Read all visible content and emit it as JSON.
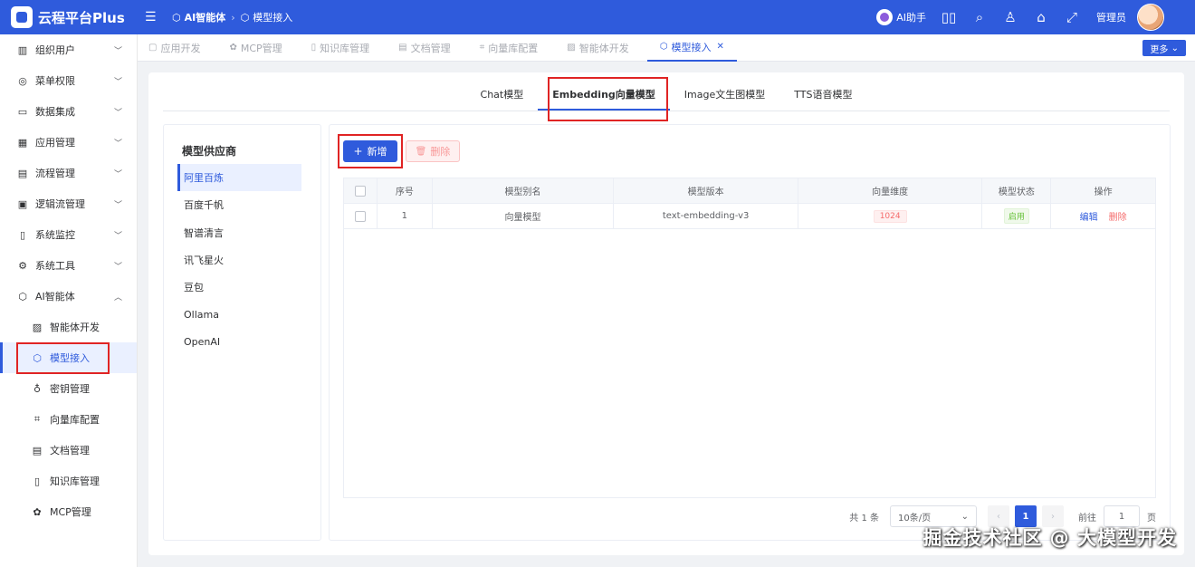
{
  "header": {
    "app_title": "云程平台Plus",
    "breadcrumbs": [
      "AI智能体",
      "模型接入"
    ],
    "ai_assistant": "AI助手",
    "user": "管理员"
  },
  "sidebar": {
    "items": [
      {
        "label": "组织用户",
        "icon": "building-icon",
        "glyph": "▥",
        "expanded": false
      },
      {
        "label": "菜单权限",
        "icon": "menu-circle-icon",
        "glyph": "◎",
        "expanded": false
      },
      {
        "label": "数据集成",
        "icon": "briefcase-icon",
        "glyph": "▭",
        "expanded": false
      },
      {
        "label": "应用管理",
        "icon": "grid-icon",
        "glyph": "▦",
        "expanded": false
      },
      {
        "label": "流程管理",
        "icon": "flow-icon",
        "glyph": "▤",
        "expanded": false
      },
      {
        "label": "逻辑流管理",
        "icon": "logic-icon",
        "glyph": "▣",
        "expanded": false
      },
      {
        "label": "系统监控",
        "icon": "monitor-icon",
        "glyph": "▯",
        "expanded": false
      },
      {
        "label": "系统工具",
        "icon": "gear-icon",
        "glyph": "⚙",
        "expanded": false
      },
      {
        "label": "AI智能体",
        "icon": "ai-icon",
        "glyph": "⬡",
        "expanded": true
      }
    ],
    "sub_items": [
      {
        "label": "智能体开发",
        "icon": "image-icon",
        "glyph": "▨"
      },
      {
        "label": "模型接入",
        "icon": "model-icon",
        "glyph": "⬡",
        "active": true
      },
      {
        "label": "密钥管理",
        "icon": "key-icon",
        "glyph": "♁"
      },
      {
        "label": "向量库配置",
        "icon": "crop-icon",
        "glyph": "⌗"
      },
      {
        "label": "文档管理",
        "icon": "document-icon",
        "glyph": "▤"
      },
      {
        "label": "知识库管理",
        "icon": "book-icon",
        "glyph": "▯"
      },
      {
        "label": "MCP管理",
        "icon": "gear-icon",
        "glyph": "✿"
      }
    ]
  },
  "page_tabs": [
    {
      "label": "应用开发",
      "glyph": "▢"
    },
    {
      "label": "MCP管理",
      "glyph": "✿"
    },
    {
      "label": "知识库管理",
      "glyph": "▯"
    },
    {
      "label": "文档管理",
      "glyph": "▤"
    },
    {
      "label": "向量库配置",
      "glyph": "⌗"
    },
    {
      "label": "智能体开发",
      "glyph": "▨"
    },
    {
      "label": "模型接入",
      "glyph": "⬡",
      "active": true,
      "close": "✕"
    }
  ],
  "more_button": "更多",
  "model_tabs": [
    {
      "label": "Chat模型",
      "active": false
    },
    {
      "label": "Embedding向量模型",
      "active": true
    },
    {
      "label": "Image文生图模型",
      "active": false
    },
    {
      "label": "TTS语音模型",
      "active": false
    }
  ],
  "providers": {
    "title": "模型供应商",
    "items": [
      {
        "label": "阿里百炼",
        "active": true
      },
      {
        "label": "百度千帆",
        "active": false
      },
      {
        "label": "智谱清言",
        "active": false
      },
      {
        "label": "讯飞星火",
        "active": false
      },
      {
        "label": "豆包",
        "active": false
      },
      {
        "label": "Ollama",
        "active": false
      },
      {
        "label": "OpenAI",
        "active": false
      }
    ]
  },
  "toolbar": {
    "add_label": "新增",
    "delete_label": "删除"
  },
  "table": {
    "columns": [
      "序号",
      "模型别名",
      "模型版本",
      "向量维度",
      "模型状态",
      "操作"
    ],
    "rows": [
      {
        "index": "1",
        "alias": "向量模型",
        "version": "text-embedding-v3",
        "dimension": "1024",
        "status": "启用",
        "edit": "编辑",
        "delete": "删除"
      }
    ]
  },
  "pagination": {
    "total_text": "共 1 条",
    "page_size": "10条/页",
    "current_page": "1",
    "goto_label": "前往",
    "goto_value": "1",
    "page_suffix": "页"
  },
  "watermark": "掘金技术社区 @ 大模型开发",
  "colors": {
    "primary": "#2f5bdc",
    "danger": "#f56c6c",
    "success": "#67c23a",
    "highlight_box": "#e02424"
  }
}
